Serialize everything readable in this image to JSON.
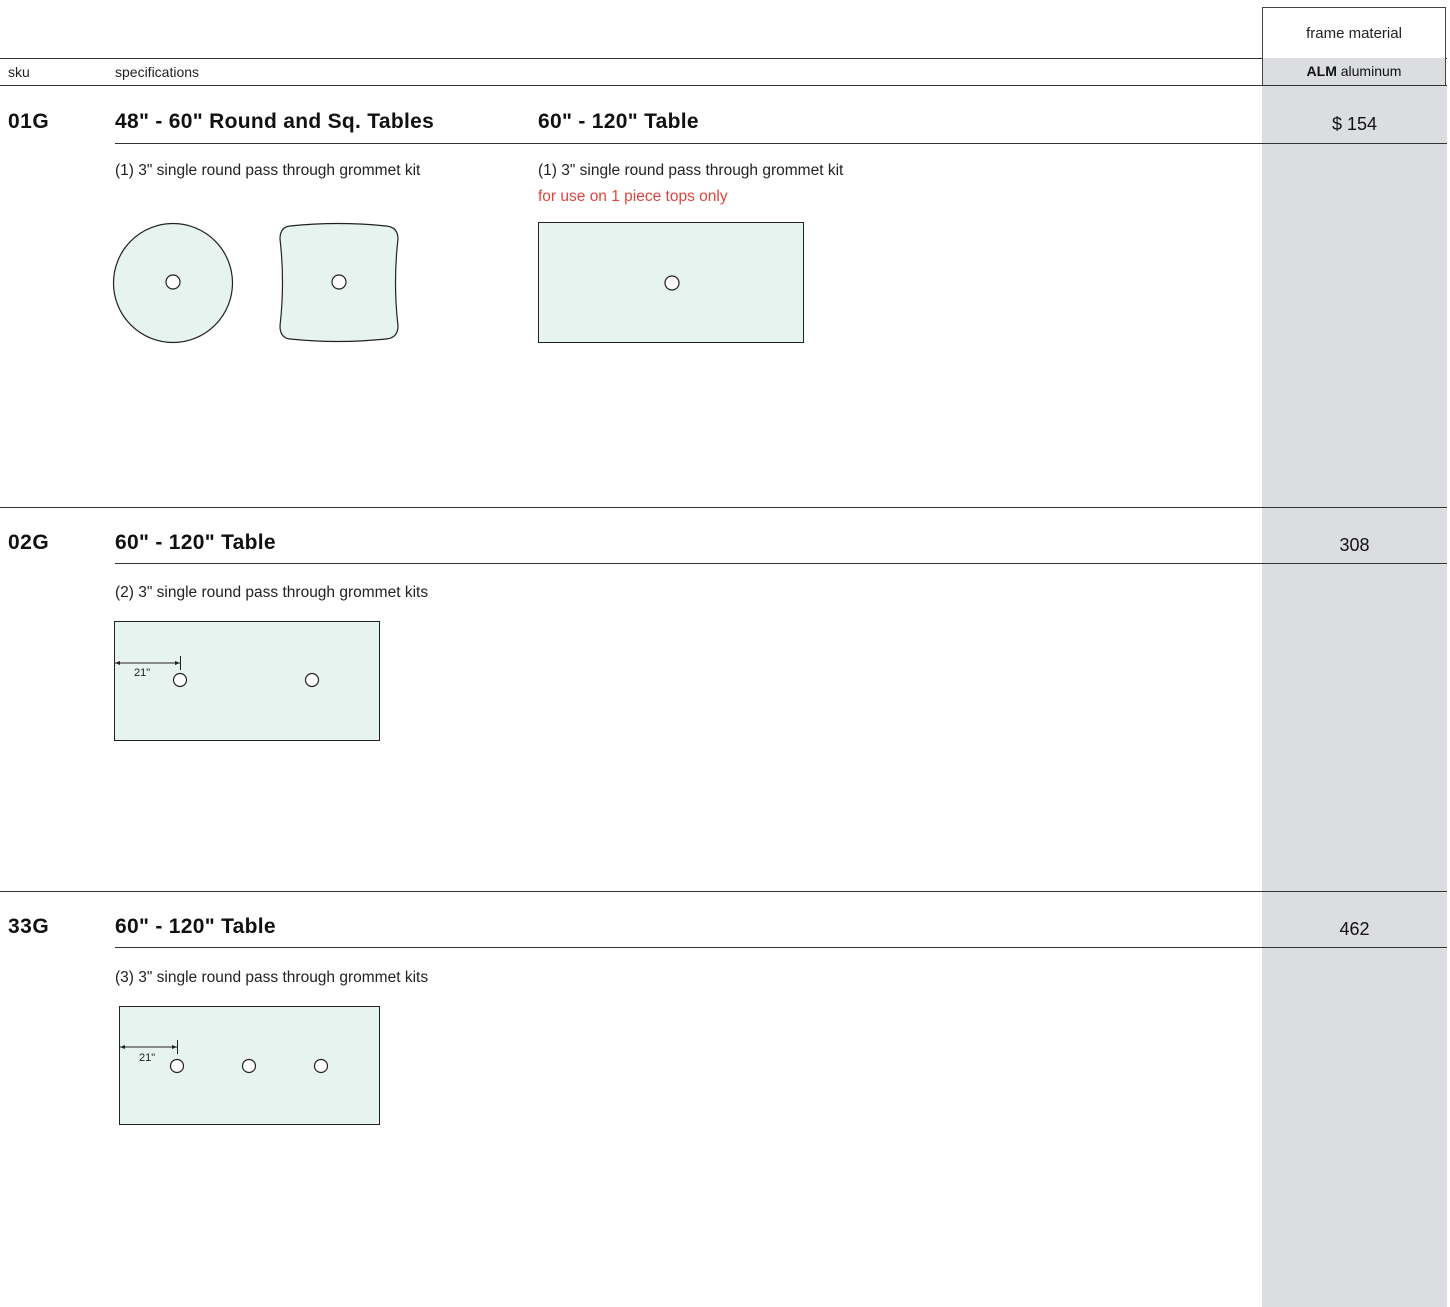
{
  "header": {
    "frame_material_label": "frame material",
    "sku_label": "sku",
    "specifications_label": "specifications",
    "material_code": "ALM",
    "material_name": "aluminum"
  },
  "rows": [
    {
      "sku": "01G",
      "price": "$ 154",
      "columns": [
        {
          "title": "48\" - 60\" Round and Sq. Tables",
          "description": "(1) 3\" single round pass through grommet kit",
          "note": ""
        },
        {
          "title": "60\" - 120\" Table",
          "description": "(1) 3\" single round pass through grommet kit",
          "note": "for use on 1 piece tops only"
        }
      ]
    },
    {
      "sku": "02G",
      "price": "308",
      "columns": [
        {
          "title": "60\" - 120\" Table",
          "description": "(2) 3\" single round pass through grommet kits",
          "dimension_label": "21\""
        }
      ]
    },
    {
      "sku": "33G",
      "price": "462",
      "columns": [
        {
          "title": "60\" - 120\" Table",
          "description": "(3) 3\" single round pass through grommet kits",
          "dimension_label": "21\""
        }
      ]
    }
  ],
  "colors": {
    "tabletop_fill": "#e6f3ef",
    "price_column_bg": "#dcdde0",
    "note_red": "#e0443e"
  }
}
